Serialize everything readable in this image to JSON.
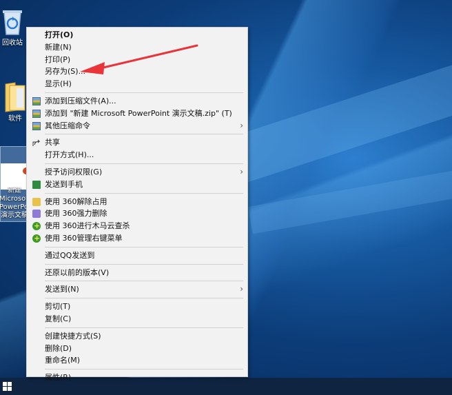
{
  "desktop": {
    "icons": [
      {
        "label": "回收站"
      },
      {
        "label": "软件"
      },
      {
        "label": "新建 Microsoft PowerPoint 演示文稿"
      }
    ]
  },
  "menu": {
    "items": [
      {
        "label": "打开(O)",
        "bold": true
      },
      {
        "label": "新建(N)"
      },
      {
        "label": "打印(P)"
      },
      {
        "label": "另存为(S)..."
      },
      {
        "label": "显示(H)"
      },
      {
        "label": "添加到压缩文件(A)...",
        "icon": "zip-icon"
      },
      {
        "label": "添加到 \"新建 Microsoft PowerPoint 演示文稿.zip\" (T)",
        "icon": "zip-icon"
      },
      {
        "label": "其他压缩命令",
        "icon": "zip-icon",
        "submenu": true
      },
      {
        "label": "共享",
        "icon": "share-icon"
      },
      {
        "label": "打开方式(H)..."
      },
      {
        "label": "授予访问权限(G)",
        "submenu": true
      },
      {
        "label": "发送到手机",
        "icon": "phone-icon"
      },
      {
        "label": "使用 360解除占用",
        "icon": "360-unlock-icon"
      },
      {
        "label": "使用 360强力删除",
        "icon": "360-delete-icon"
      },
      {
        "label": "使用 360进行木马云查杀",
        "icon": "360-scan-icon"
      },
      {
        "label": "使用 360管理右键菜单",
        "icon": "360-manage-icon"
      },
      {
        "label": "通过QQ发送到"
      },
      {
        "label": "还原以前的版本(V)"
      },
      {
        "label": "发送到(N)",
        "submenu": true
      },
      {
        "label": "剪切(T)"
      },
      {
        "label": "复制(C)"
      },
      {
        "label": "创建快捷方式(S)"
      },
      {
        "label": "删除(D)"
      },
      {
        "label": "重命名(M)"
      },
      {
        "label": "属性(R)"
      }
    ],
    "submenu_glyph": "›"
  },
  "colors": {
    "annotation_arrow": "#e8343a",
    "menu_bg": "#f2f2f2"
  }
}
